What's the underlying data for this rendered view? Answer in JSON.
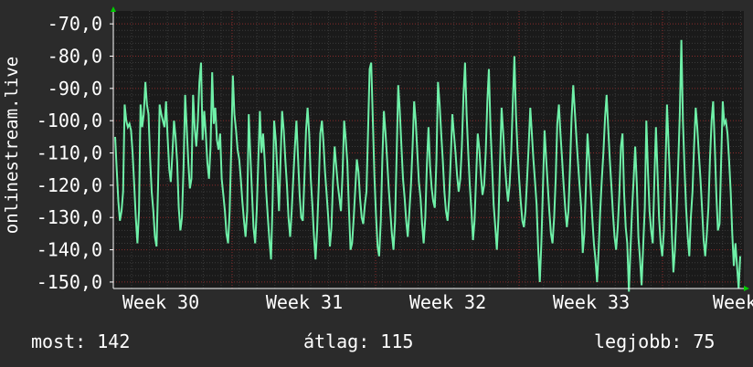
{
  "chart_data": {
    "type": "line",
    "ylabel": "onlinestream.live",
    "ylim": [
      -152,
      -66
    ],
    "yticks": [
      -70,
      -80,
      -90,
      -100,
      -110,
      -120,
      -130,
      -140,
      -150
    ],
    "ytick_labels": [
      "-70,0",
      "-80,0",
      "-90,0",
      "-100,0",
      "-110,0",
      "-120,0",
      "-130,0",
      "-140,0",
      "-150,0"
    ],
    "x_categories": [
      "Week 30",
      "Week 31",
      "Week 32",
      "Week 33",
      "Week"
    ],
    "grid": true,
    "colors": {
      "line": "#6ff0a8",
      "grid": "#8a2a2a",
      "background": "#2b2b2b",
      "plot": "#1a1a1a",
      "axis": "#ffffff",
      "arrow": "#00cc00"
    },
    "series": [
      {
        "values": [
          -105,
          -115,
          -125,
          -131,
          -128,
          -122,
          -95,
          -100,
          -102,
          -101,
          -103,
          -110,
          -120,
          -130,
          -138,
          -128,
          -95,
          -102,
          -98,
          -88,
          -95,
          -98,
          -112,
          -122,
          -128,
          -136,
          -139,
          -120,
          -95,
          -98,
          -100,
          -102,
          -94,
          -105,
          -115,
          -119,
          -110,
          -100,
          -105,
          -113,
          -127,
          -134,
          -130,
          -115,
          -92,
          -102,
          -113,
          -121,
          -118,
          -92,
          -102,
          -108,
          -100,
          -88,
          -82,
          -106,
          -97,
          -104,
          -113,
          -118,
          -108,
          -85,
          -101,
          -96,
          -106,
          -109,
          -104,
          -118,
          -123,
          -128,
          -135,
          -138,
          -128,
          -108,
          -86,
          -98,
          -103,
          -109,
          -112,
          -118,
          -125,
          -131,
          -136,
          -128,
          -98,
          -110,
          -122,
          -133,
          -138,
          -128,
          -113,
          -97,
          -110,
          -104,
          -112,
          -122,
          -130,
          -137,
          -143,
          -125,
          -100,
          -106,
          -116,
          -128,
          -112,
          -97,
          -103,
          -112,
          -120,
          -130,
          -136,
          -128,
          -118,
          -108,
          -100,
          -112,
          -123,
          -130,
          -131,
          -118,
          -103,
          -96,
          -104,
          -118,
          -126,
          -136,
          -143,
          -134,
          -120,
          -104,
          -100,
          -107,
          -116,
          -123,
          -130,
          -139,
          -133,
          -119,
          -108,
          -114,
          -120,
          -124,
          -128,
          -116,
          -100,
          -106,
          -113,
          -127,
          -140,
          -138,
          -130,
          -121,
          -112,
          -116,
          -124,
          -130,
          -132,
          -126,
          -122,
          -104,
          -84,
          -82,
          -100,
          -117,
          -129,
          -139,
          -142,
          -131,
          -112,
          -97,
          -104,
          -112,
          -121,
          -128,
          -135,
          -140,
          -131,
          -110,
          -89,
          -97,
          -108,
          -118,
          -124,
          -131,
          -136,
          -128,
          -120,
          -108,
          -94,
          -100,
          -110,
          -119,
          -124,
          -132,
          -138,
          -130,
          -114,
          -102,
          -114,
          -121,
          -125,
          -127,
          -112,
          -88,
          -95,
          -104,
          -112,
          -122,
          -128,
          -131,
          -124,
          -112,
          -98,
          -104,
          -110,
          -117,
          -122,
          -118,
          -108,
          -92,
          -82,
          -98,
          -110,
          -120,
          -128,
          -137,
          -131,
          -117,
          -104,
          -109,
          -117,
          -123,
          -120,
          -110,
          -94,
          -84,
          -102,
          -114,
          -126,
          -133,
          -140,
          -130,
          -113,
          -96,
          -104,
          -113,
          -120,
          -125,
          -120,
          -110,
          -95,
          -80,
          -98,
          -109,
          -118,
          -125,
          -131,
          -133,
          -128,
          -118,
          -108,
          -96,
          -104,
          -112,
          -119,
          -126,
          -140,
          -150,
          -138,
          -120,
          -103,
          -112,
          -120,
          -128,
          -135,
          -138,
          -130,
          -118,
          -101,
          -95,
          -104,
          -112,
          -120,
          -127,
          -133,
          -128,
          -114,
          -99,
          -89,
          -97,
          -105,
          -113,
          -120,
          -127,
          -141,
          -135,
          -120,
          -104,
          -112,
          -121,
          -130,
          -138,
          -143,
          -150,
          -140,
          -128,
          -118,
          -110,
          -99,
          -92,
          -102,
          -112,
          -120,
          -129,
          -136,
          -140,
          -133,
          -123,
          -108,
          -104,
          -122,
          -133,
          -138,
          -153,
          -140,
          -128,
          -118,
          -108,
          -120,
          -136,
          -143,
          -151,
          -139,
          -127,
          -100,
          -116,
          -128,
          -134,
          -138,
          -119,
          -102,
          -116,
          -130,
          -138,
          -142,
          -134,
          -115,
          -95,
          -108,
          -120,
          -135,
          -147,
          -140,
          -128,
          -114,
          -98,
          -75,
          -100,
          -115,
          -127,
          -136,
          -142,
          -130,
          -122,
          -108,
          -96,
          -102,
          -110,
          -118,
          -127,
          -137,
          -142,
          -135,
          -127,
          -112,
          -100,
          -94,
          -108,
          -123,
          -134,
          -132,
          -113,
          -94,
          -101,
          -100,
          -104,
          -112,
          -122,
          -135,
          -145,
          -138,
          -145,
          -152,
          -142
        ]
      }
    ]
  },
  "stats": {
    "now_label": "most:",
    "now_value": "142",
    "avg_label": "átlag:",
    "avg_value": "115",
    "best_label": "legjobb:",
    "best_value": "75"
  }
}
